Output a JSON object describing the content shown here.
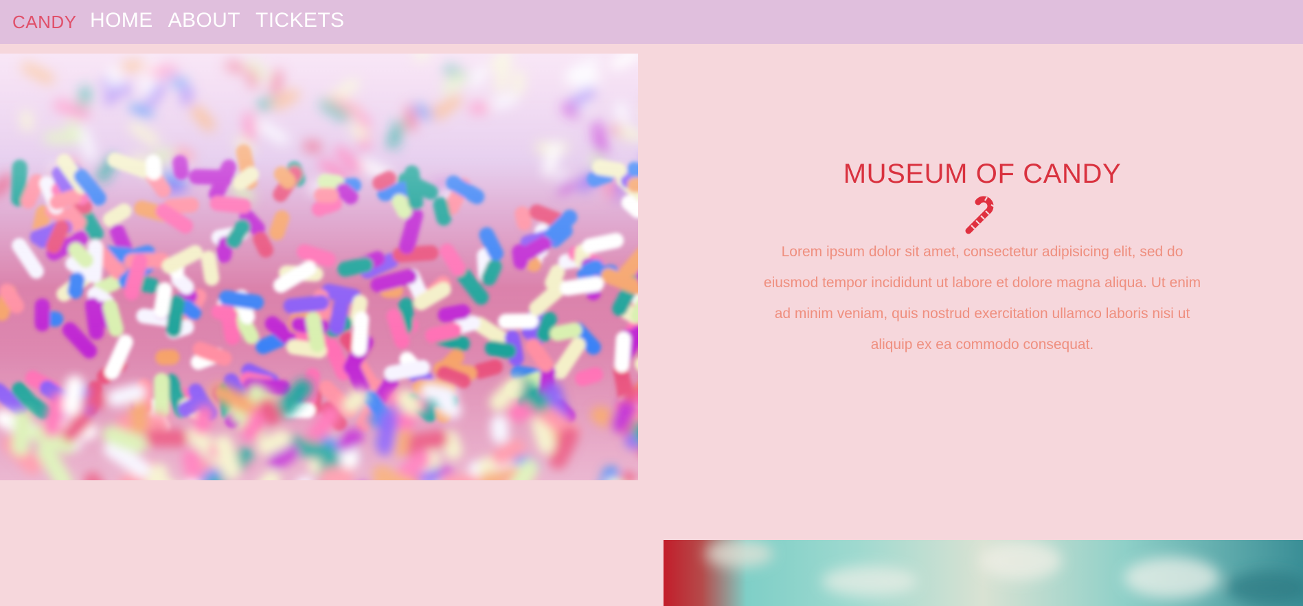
{
  "nav": {
    "brand": "CANDY",
    "links": [
      {
        "label": "HOME"
      },
      {
        "label": "ABOUT"
      },
      {
        "label": "TICKETS"
      }
    ]
  },
  "hero": {
    "title": "MUSEUM OF CANDY",
    "icon": "candy-cane-icon",
    "body": "Lorem ipsum dolor sit amet, consectetur adipisicing elit, sed do eiusmod tempor incididunt ut labore et dolore magna aliqua. Ut enim ad minim veniam, quis nostrud exercitation ullamco laboris nisi ut aliquip ex ea commodo consequat."
  },
  "colors": {
    "navbar_bg": "#e0bfdd",
    "page_bg": "#f6d7dc",
    "brand": "#e0506a",
    "title": "#d9323f",
    "body": "#ef8f7f"
  }
}
